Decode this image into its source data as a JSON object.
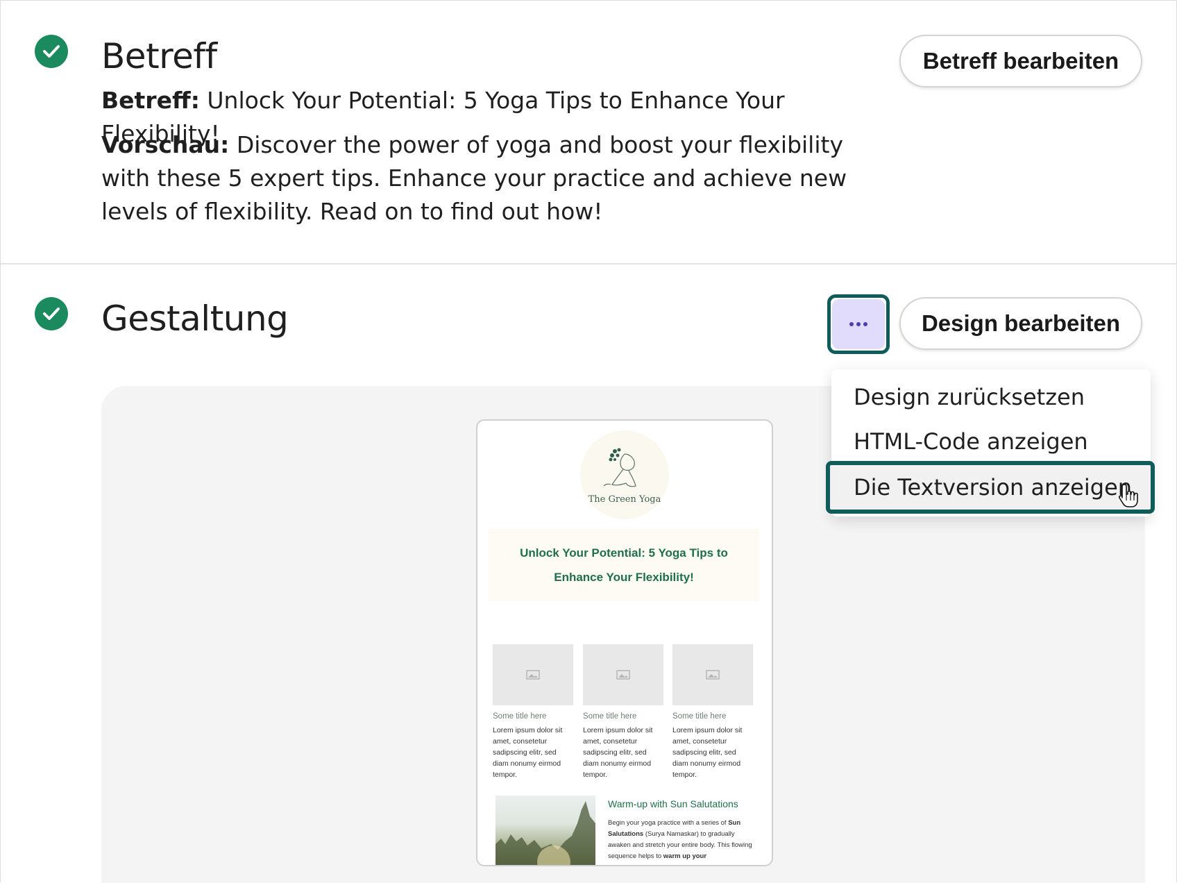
{
  "subject_section": {
    "title": "Betreff",
    "edit_button": "Betreff bearbeiten",
    "subject_label": "Betreff:",
    "subject_value": "Unlock Your Potential: 5 Yoga Tips to Enhance Your Flexibility!",
    "preview_label": "Vorschau:",
    "preview_value": "Discover the power of yoga and boost your flexibility with these 5 expert tips. Enhance your practice and achieve new levels of flexibility. Read on to find out how!"
  },
  "design_section": {
    "title": "Gestaltung",
    "edit_button": "Design bearbeiten",
    "more_menu": {
      "items": [
        {
          "label": "Design zurücksetzen"
        },
        {
          "label": "HTML-Code anzeigen"
        },
        {
          "label": "Die Textversion anzeigen"
        }
      ],
      "active_index": 2
    }
  },
  "email_preview": {
    "logo_text": "The Green Yoga",
    "hero_title": "Unlock Your Potential: 5 Yoga Tips to Enhance Your Flexibility!",
    "cards": [
      {
        "title": "Some title here",
        "body": "Lorem ipsum dolor sit amet, consetetur sadipscing elitr, sed diam nonumy eirmod tempor."
      },
      {
        "title": "Some title here",
        "body": "Lorem ipsum dolor sit amet, consetetur sadipscing elitr, sed diam nonumy eirmod tempor."
      },
      {
        "title": "Some title here",
        "body": "Lorem ipsum dolor sit amet, consetetur sadipscing elitr, sed diam nonumy eirmod tempor."
      }
    ],
    "feature": {
      "title": "Warm-up with Sun Salutations",
      "body_1": "Begin your yoga practice with a series of ",
      "body_bold_1": "Sun Salutations",
      "body_2": " (Surya Namaskar) to gradually awaken and stretch your entire body. This flowing sequence helps to ",
      "body_bold_2": "warm up your"
    }
  },
  "colors": {
    "check_green": "#1b8a5e",
    "focus_ring": "#0f5c5b",
    "more_button_bg": "#e1dcfb",
    "brand_green": "#1f6f4a"
  },
  "icons": {
    "status": "check-circle-icon",
    "more": "more-horizontal-icon",
    "image_placeholder": "image-placeholder-icon",
    "cursor": "hand-pointer-icon"
  }
}
